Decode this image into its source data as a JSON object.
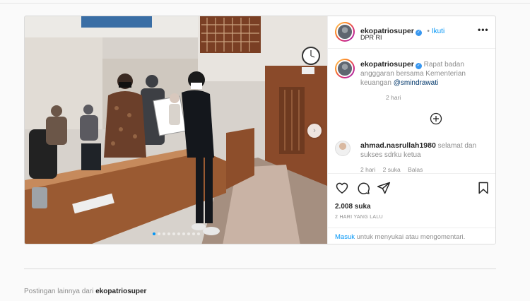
{
  "post": {
    "username": "ekopatriosuper",
    "follow_label": "Ikuti",
    "location": "DPR RI",
    "more_icon": "more-horizontal-icon",
    "caption_text": "Rapat badan angggaran bersama Kementerian keuangan",
    "caption_mention": "@smindrawati",
    "caption_time": "2 hari",
    "load_more_icon": "add-circle-icon",
    "media_next_icon": "chevron-right-icon",
    "carousel_count": 10,
    "carousel_active_index": 0
  },
  "comments": [
    {
      "username": "ahmad.nasrullah1980",
      "text": "selamat dan sukses sdrku ketua",
      "time": "2 hari",
      "likes": "2 suka",
      "reply_label": "Balas"
    }
  ],
  "actions": {
    "like_icon": "heart-icon",
    "comment_icon": "comment-icon",
    "share_icon": "share-icon",
    "save_icon": "bookmark-icon",
    "likes_count": "2.008 suka",
    "timestamp": "2 HARI YANG LALU"
  },
  "login_prompt": {
    "link": "Masuk",
    "text": "untuk menyukai atau mengomentari."
  },
  "more_posts": {
    "prefix": "Postingan lainnya dari",
    "username": "ekopatriosuper"
  },
  "colors": {
    "accent": "#0095f6",
    "verified": "#3897f0",
    "border": "#dbdbdb"
  }
}
